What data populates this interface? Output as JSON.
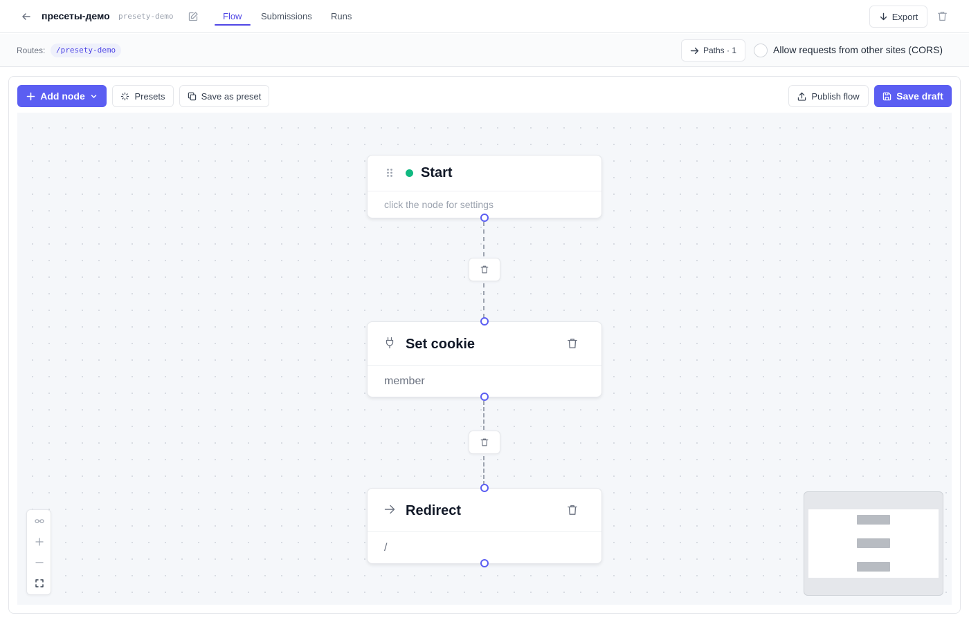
{
  "header": {
    "title": "пресеты-демо",
    "slug": "presety-demo",
    "tabs": [
      {
        "label": "Flow",
        "active": true
      },
      {
        "label": "Submissions",
        "active": false
      },
      {
        "label": "Runs",
        "active": false
      }
    ],
    "export_label": "Export"
  },
  "routes": {
    "label": "Routes:",
    "items": [
      "/presety-demo"
    ],
    "paths_label": "Paths · 1",
    "cors_label": "Allow requests from other sites (CORS)",
    "cors_checked": false
  },
  "toolbar": {
    "add_node_label": "Add node",
    "presets_label": "Presets",
    "save_preset_label": "Save as preset",
    "publish_label": "Publish flow",
    "save_draft_label": "Save draft"
  },
  "nodes": [
    {
      "title": "Start",
      "subtitle": "click the node for settings",
      "icon": "drag-handle-icon",
      "status_color": "#10b981"
    },
    {
      "title": "Set cookie",
      "subtitle": "member",
      "icon": "plug-icon"
    },
    {
      "title": "Redirect",
      "subtitle": "/",
      "icon": "arrow-right-icon"
    }
  ],
  "colors": {
    "accent": "#5b5ef2",
    "accent_text": "#4f46e5",
    "status_active": "#10b981"
  }
}
